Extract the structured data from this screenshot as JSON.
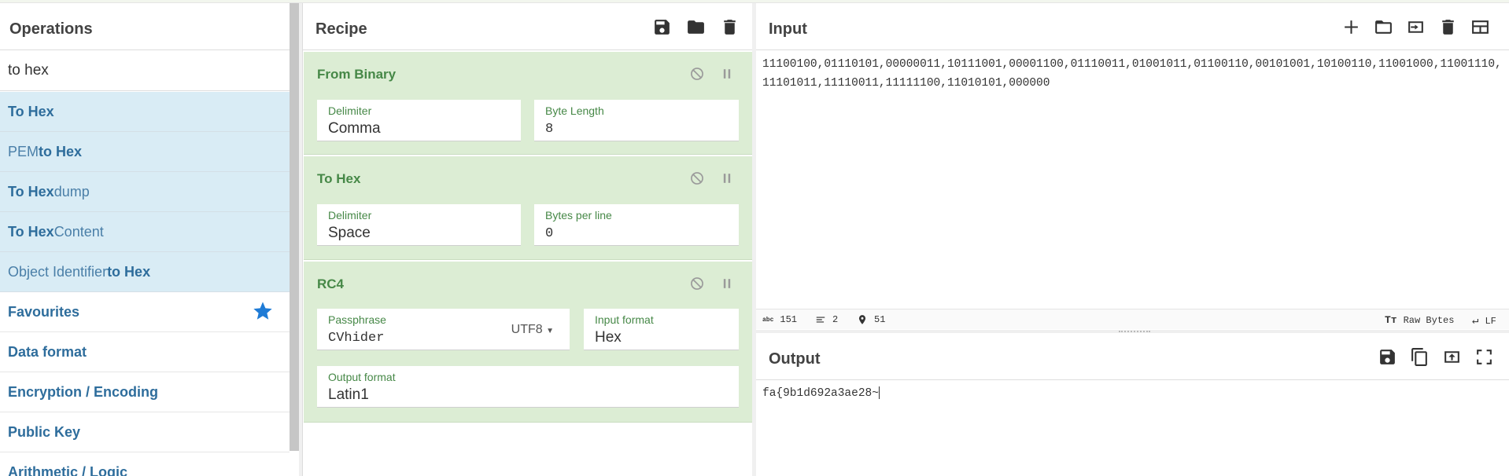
{
  "operations": {
    "title": "Operations",
    "search_value": "to hex",
    "results": [
      {
        "pre": "",
        "bold": "To Hex",
        "post": ""
      },
      {
        "pre": "PEM ",
        "bold": "to Hex",
        "post": ""
      },
      {
        "pre": "",
        "bold": "To Hex",
        "post": "dump"
      },
      {
        "pre": "",
        "bold": "To Hex",
        "post": " Content"
      },
      {
        "pre": "Object Identifier ",
        "bold": "to Hex",
        "post": ""
      }
    ],
    "categories": [
      "Favourites",
      "Data format",
      "Encryption / Encoding",
      "Public Key",
      "Arithmetic / Logic"
    ]
  },
  "recipe": {
    "title": "Recipe",
    "icons": [
      "save-icon",
      "folder-icon",
      "trash-icon"
    ],
    "ops": [
      {
        "name": "From Binary",
        "fields": [
          {
            "label": "Delimiter",
            "value": "Comma"
          },
          {
            "label": "Byte Length",
            "value": "8"
          }
        ]
      },
      {
        "name": "To Hex",
        "fields": [
          {
            "label": "Delimiter",
            "value": "Space"
          },
          {
            "label": "Bytes per line",
            "value": "0"
          }
        ]
      },
      {
        "name": "RC4",
        "fields": [
          {
            "label": "Passphrase",
            "value": "CVhider",
            "encoding": "UTF8"
          },
          {
            "label": "Input format",
            "value": "Hex"
          },
          {
            "label": "Output format",
            "value": "Latin1"
          }
        ]
      }
    ]
  },
  "input": {
    "title": "Input",
    "text": "11100100,01110101,00000011,10111001,00001100,01110011,01001011,01100110,00101001,10100110,11001000,11001110,11101011,11110011,11111100,11010101,000000",
    "status": {
      "chars": "151",
      "lines": "2",
      "position": "51",
      "format": "Raw Bytes",
      "eol": "LF"
    }
  },
  "output": {
    "title": "Output",
    "text": "fa{9b1d692a3ae28~"
  },
  "colors": {
    "accent_green": "#468847",
    "op_bg": "#dcedd4",
    "result_bg": "#d9ecf5",
    "link_blue": "#2e6d9c",
    "star": "#1e7bd6"
  }
}
